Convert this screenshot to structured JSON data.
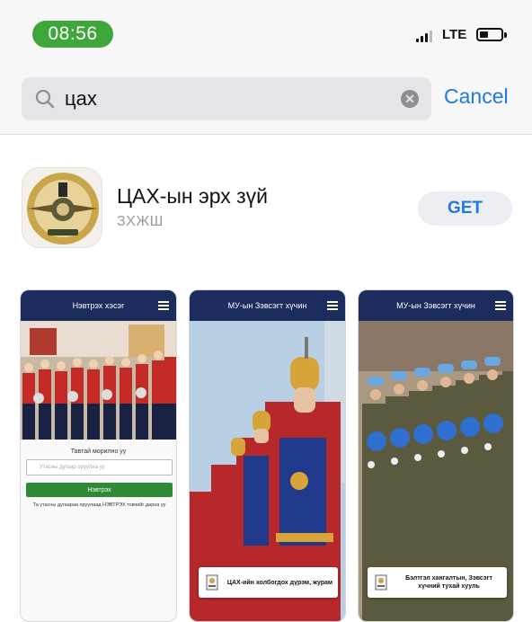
{
  "status_bar": {
    "time": "08:56",
    "network": "LTE"
  },
  "search": {
    "query": "цах",
    "cancel_label": "Cancel"
  },
  "result": {
    "app_name": "ЦАХ-ын эрх зүй",
    "developer": "ЗХЖШ",
    "get_label": "GET"
  },
  "screenshots": [
    {
      "header": "Нэвтрэх хэсэг",
      "caption": "Тавтай морилно уу",
      "input_placeholder": "Утасны дугаар оруулна уу",
      "button_label": "Нэвтрэх",
      "note": "Та утасны дугаараа оруулаад НЭВТРЭХ товчийг дарна уу"
    },
    {
      "header": "МУ-ын Зэвсэгт хүчин",
      "card_text": "ЦАХ-ийн холбогдох дүрэм, журам"
    },
    {
      "header": "МУ-ын Зэвсэгт хүчин",
      "card_text": "Бэлтгэл хангалтын, Зэвсэгт хүчний тухай хууль"
    }
  ],
  "colors": {
    "accent": "#1f7ae0",
    "time_pill": "#3fa63a",
    "app_header": "#1c2c5c",
    "app_button": "#2f8a38"
  },
  "icons": [
    "search-icon",
    "clear-icon",
    "signal-icon",
    "battery-icon",
    "app-emblem-icon",
    "menu-icon",
    "document-icon"
  ]
}
